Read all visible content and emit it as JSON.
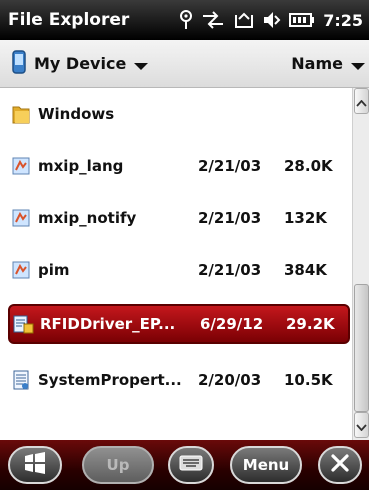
{
  "title_bar": {
    "title": "File Explorer",
    "time": "7:25"
  },
  "path_bar": {
    "location": "My Device",
    "sort_label": "Name"
  },
  "files": [
    {
      "name": "Windows",
      "date": "",
      "size": "",
      "icon": "folder-icon"
    },
    {
      "name": "mxip_lang",
      "date": "2/21/03",
      "size": "28.0K",
      "icon": "file-icon"
    },
    {
      "name": "mxip_notify",
      "date": "2/21/03",
      "size": "132K",
      "icon": "file-icon"
    },
    {
      "name": "pim",
      "date": "2/21/03",
      "size": "384K",
      "icon": "file-icon"
    },
    {
      "name": "RFIDDriver_EP...",
      "date": "6/29/12",
      "size": "29.2K",
      "icon": "installer-icon",
      "selected": true
    },
    {
      "name": "SystemPropert...",
      "date": "2/20/03",
      "size": "10.5K",
      "icon": "document-icon"
    }
  ],
  "bottom_bar": {
    "up_label": "Up",
    "menu_label": "Menu"
  },
  "colors": {
    "selection": "#b01217",
    "bottom_bar": "#3a0000"
  }
}
